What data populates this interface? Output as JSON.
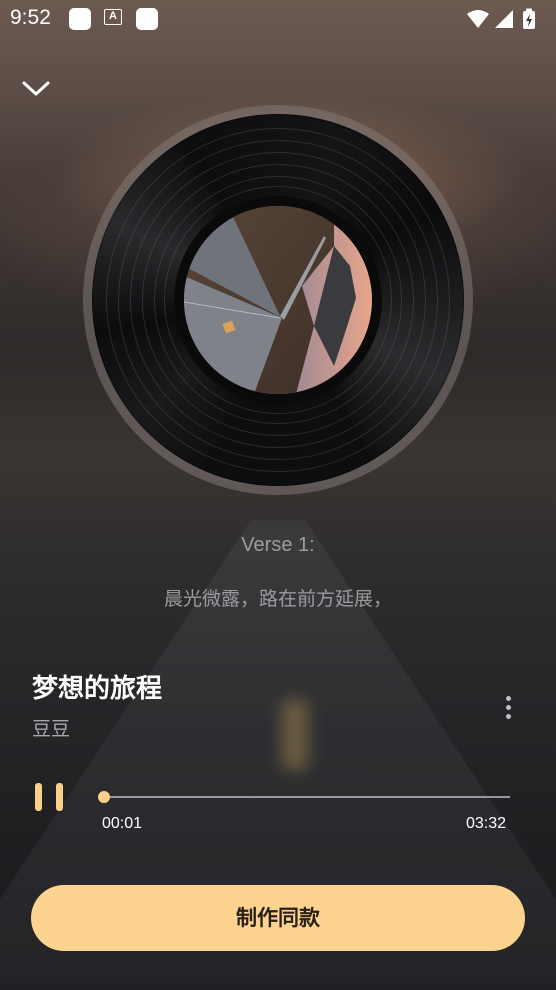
{
  "status_bar": {
    "time": "9:52",
    "notification_icons": [
      "app-icon",
      "a-icon",
      "app-icon"
    ],
    "system_icons": [
      "wifi-icon",
      "signal-icon",
      "battery-charging-icon"
    ]
  },
  "header": {
    "collapse_icon": "chevron-down-icon"
  },
  "lyrics": {
    "heading": "Verse 1:",
    "line": "晨光微露，路在前方延展，"
  },
  "song": {
    "title": "梦想的旅程",
    "artist": "豆豆",
    "more_icon": "more-vertical-icon"
  },
  "player": {
    "state_icon": "pause-icon",
    "current_time": "00:01",
    "total_time": "03:32",
    "progress": 0.005
  },
  "actions": {
    "make_same_label": "制作同款"
  },
  "colors": {
    "accent": "#fcd38f",
    "button_text": "#2a2017"
  }
}
